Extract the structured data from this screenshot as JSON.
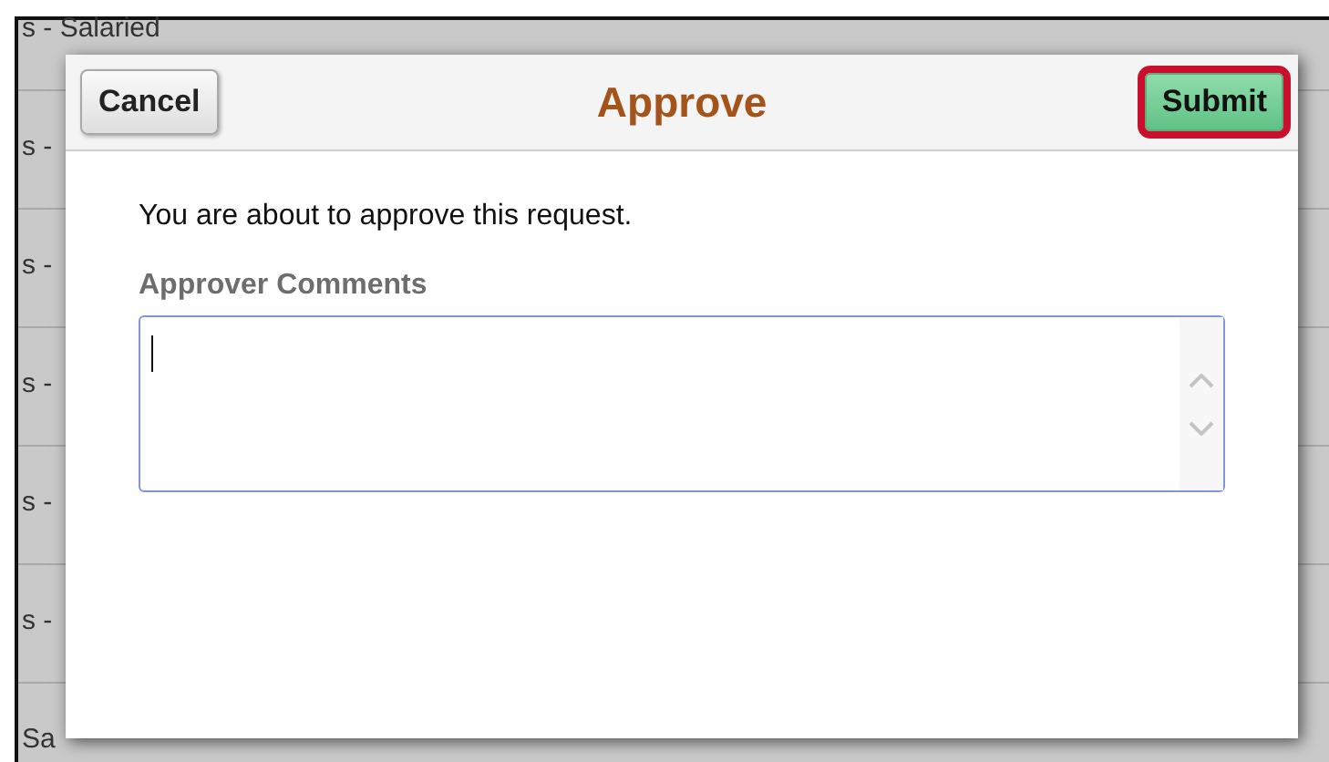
{
  "background_rows": [
    "s - Salaried",
    "s -",
    "s -",
    "s -",
    "s -",
    "s -",
    "Sa"
  ],
  "dialog": {
    "title": "Approve",
    "cancel_button": "Cancel",
    "submit_button": {
      "label": "Submit",
      "highlighted": true
    },
    "message": "You are about to approve this request.",
    "comments": {
      "label": "Approver Comments",
      "focused": true
    }
  }
}
